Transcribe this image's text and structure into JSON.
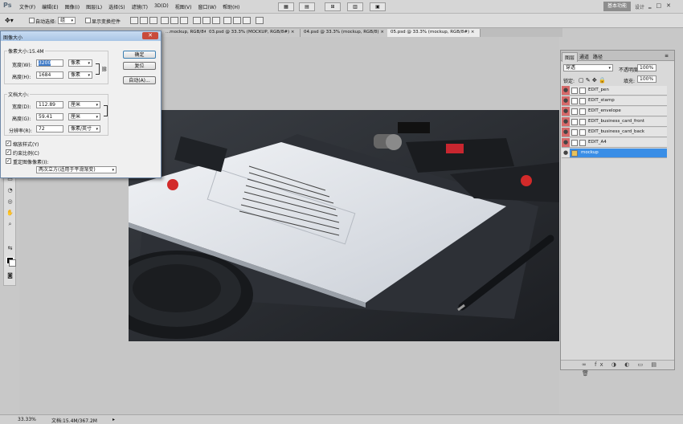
{
  "app": {
    "logo": "Ps"
  },
  "menubar": {
    "items": [
      "文件(F)",
      "编辑(E)",
      "图像(I)",
      "图层(L)",
      "选择(S)",
      "滤镜(T)",
      "3D(D)",
      "视图(V)",
      "窗口(W)",
      "帮助(H)"
    ],
    "workspace_button": "基本功能",
    "design_label": "设计"
  },
  "options": {
    "auto_select_label": "自动选择:",
    "auto_select_value": "组",
    "show_transform_label": "显示变换控件"
  },
  "tabs": [
    {
      "label": "...mockup, RGB/8#)"
    },
    {
      "label": "03.psd @ 33.3% (MOCKUP, RGB/8#)"
    },
    {
      "label": "04.psd @ 33.3% (mockup, RGB/8)"
    },
    {
      "label": "05.psd @ 33.3% (mockup, RGB/8#)",
      "active": true
    }
  ],
  "status": {
    "zoom": "33.33%",
    "doc": "文档:15.4M/367.2M"
  },
  "layers_panel": {
    "tabs": [
      "图层",
      "通道",
      "路径"
    ],
    "blend_mode": "穿透",
    "opacity_label": "不透明度:",
    "opacity_value": "100%",
    "lock_label": "锁定:",
    "fill_label": "填充:",
    "fill_value": "100%",
    "layers": [
      {
        "name": "EDIT_pen"
      },
      {
        "name": "EDIT_stamp"
      },
      {
        "name": "EDIT_envelope"
      },
      {
        "name": "EDIT_business_card_front"
      },
      {
        "name": "EDIT_business_card_back"
      },
      {
        "name": "EDIT_A4"
      },
      {
        "name": "mockup",
        "selected": true
      }
    ]
  },
  "dialog": {
    "title": "图像大小",
    "pixel_dims_label": "像素大小:15.4M",
    "width_label": "宽度(W):",
    "width_value": "3200",
    "width_unit": "像素",
    "height_label": "高度(H):",
    "height_value": "1684",
    "height_unit": "像素",
    "doc_size_label": "文档大小:",
    "doc_width_label": "宽度(D):",
    "doc_width_value": "112.89",
    "doc_width_unit": "厘米",
    "doc_height_label": "高度(G):",
    "doc_height_value": "59.41",
    "doc_height_unit": "厘米",
    "resolution_label": "分辨率(R):",
    "resolution_value": "72",
    "resolution_unit": "像素/英寸",
    "scale_styles": "缩放样式(Y)",
    "constrain": "约束比例(C)",
    "resample": "重定图像像素(I):",
    "resample_method": "两次立方(适用于平滑渐变)",
    "ok": "确定",
    "reset": "复位",
    "auto": "自动(A)..."
  }
}
